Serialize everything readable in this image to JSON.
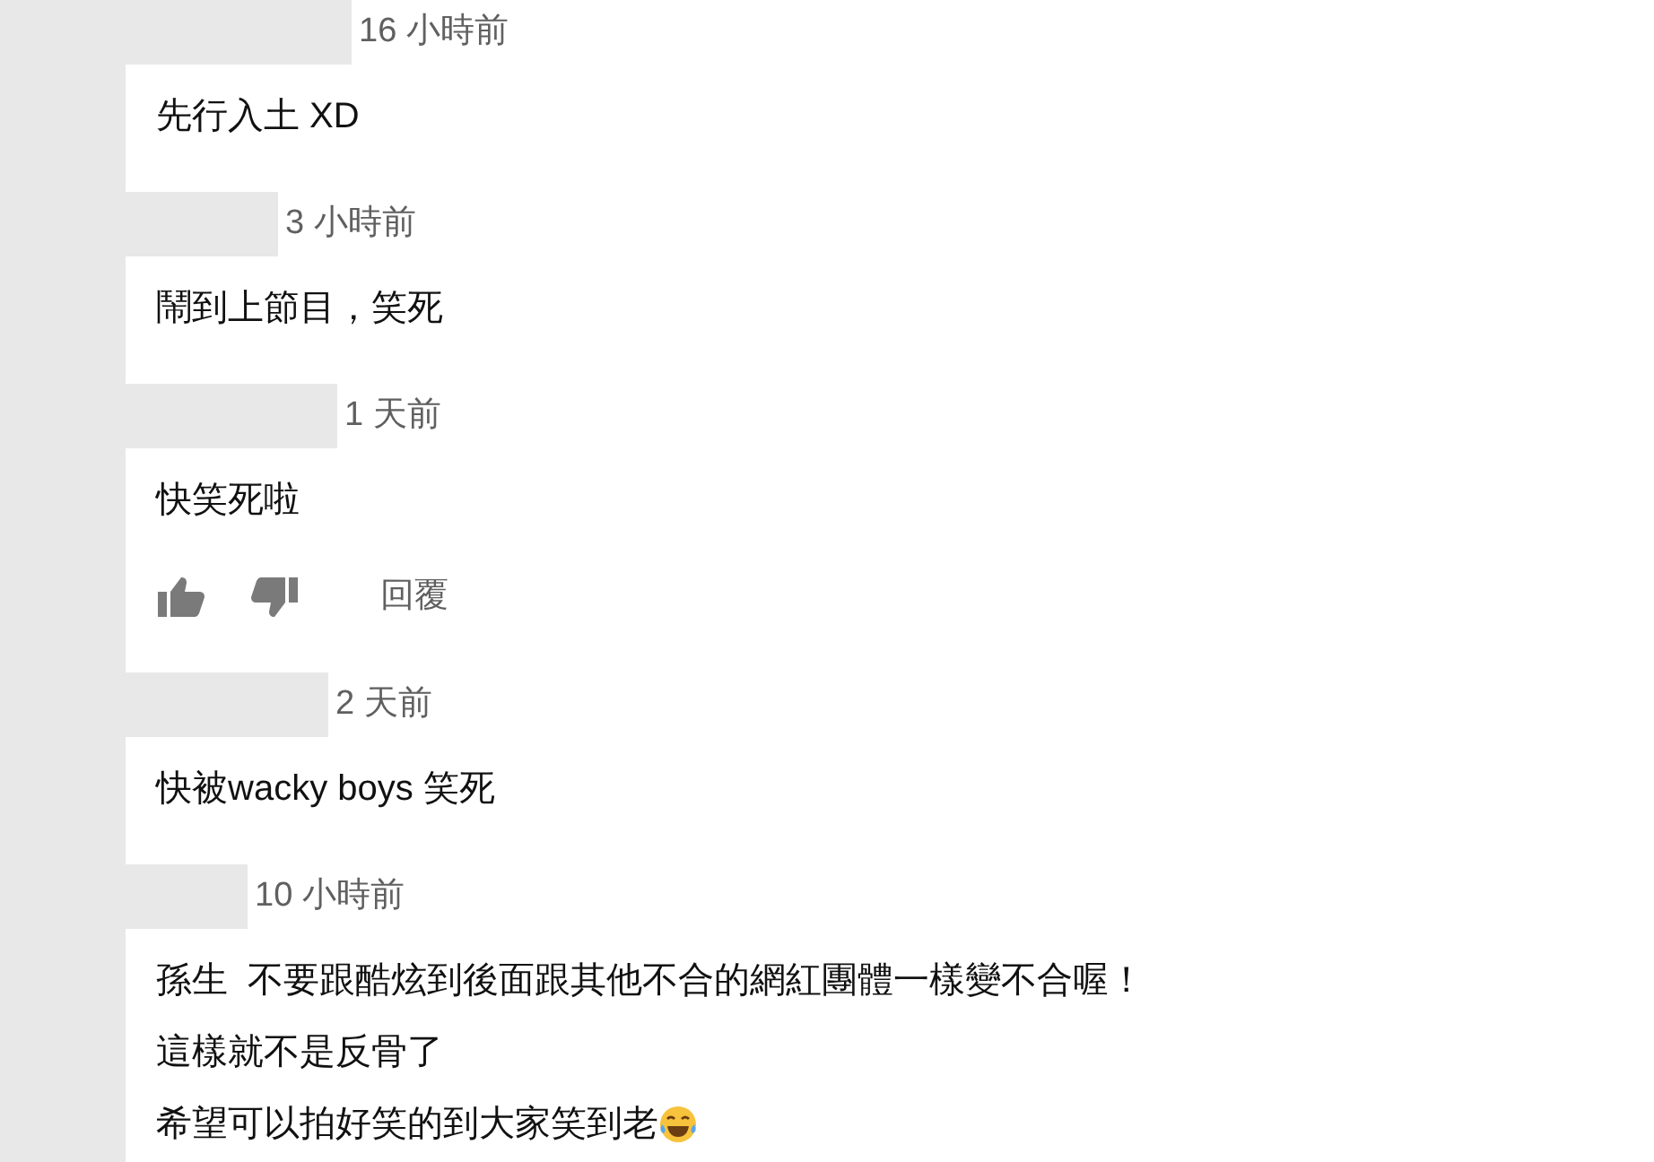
{
  "comments": [
    {
      "time": "16 小時前",
      "lines": [
        "先行入土 XD"
      ],
      "actions": false,
      "emoji": false
    },
    {
      "time": "3 小時前",
      "lines": [
        "鬧到上節目，笑死"
      ],
      "actions": false,
      "emoji": false
    },
    {
      "time": "1 天前",
      "lines": [
        "快笑死啦"
      ],
      "actions": true,
      "reply_label": "回覆",
      "emoji": false
    },
    {
      "time": "2 天前",
      "lines": [
        "快被wacky boys 笑死"
      ],
      "actions": false,
      "emoji": false
    },
    {
      "time": "10 小時前",
      "lines": [
        "孫生  不要跟酷炫到後面跟其他不合的網紅團體一樣變不合喔！",
        "這樣就不是反骨了",
        "希望可以拍好笑的到大家笑到老"
      ],
      "actions": false,
      "emoji": true
    }
  ]
}
